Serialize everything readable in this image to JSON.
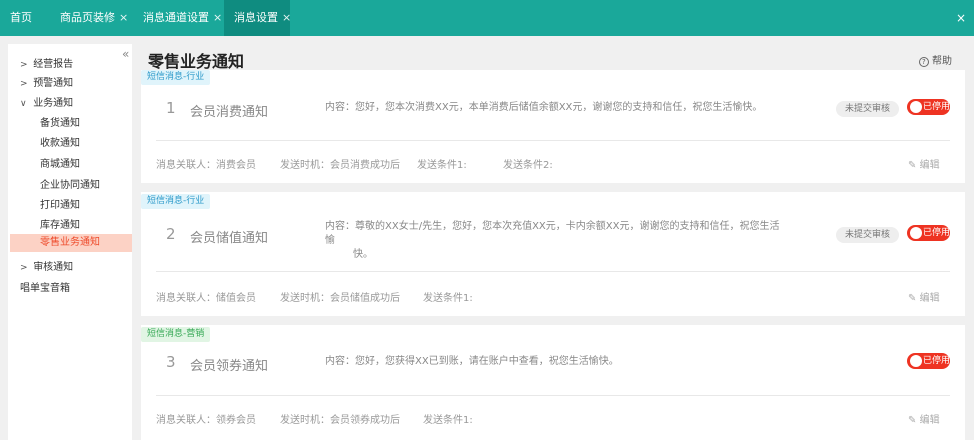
{
  "topbar": {
    "tabs": [
      {
        "label": "首页",
        "closable": false
      },
      {
        "label": "商品页装修",
        "closable": true
      },
      {
        "label": "消息通道设置",
        "closable": true
      },
      {
        "label": "消息设置",
        "closable": true,
        "active": true
      }
    ],
    "close_glyph": "×",
    "tab_close_glyph": "×"
  },
  "sidebar": {
    "collapse_glyph": "«",
    "items": [
      {
        "label": "经营报告",
        "chevron": ">"
      },
      {
        "label": "预警通知",
        "chevron": ">"
      },
      {
        "label": "业务通知",
        "chevron": "∨"
      },
      {
        "label": "备货通知"
      },
      {
        "label": "收款通知"
      },
      {
        "label": "商城通知"
      },
      {
        "label": "企业协同通知"
      },
      {
        "label": "打印通知"
      },
      {
        "label": "库存通知"
      },
      {
        "label": "零售业务通知",
        "active": true
      },
      {
        "label": "审核通知",
        "chevron": ">"
      },
      {
        "label": "唱单宝音箱"
      }
    ]
  },
  "main": {
    "title": "零售业务通知",
    "help_icon": "?",
    "help_label": "帮助",
    "edit_label": "编辑",
    "cards": [
      {
        "tag": "短信消息-行业",
        "number": "1",
        "name": "会员消费通知",
        "content": "内容：您好，您本次消费XX元，本单消费后储值余额XX元，谢谢您的支持和信任，祝您生活愉快。",
        "badge": "未提交审核",
        "toggle": "已停用",
        "meta": [
          "消息关联人：消费会员",
          "发送时机：会员消费成功后",
          "发送条件1:",
          "发送条件2:"
        ]
      },
      {
        "tag": "短信消息-行业",
        "number": "2",
        "name": "会员储值通知",
        "content_lines": [
          "内容：尊敬的XX女士/先生，您好，您本次充值XX元，卡内余额XX元，谢谢您的支持和信任，祝您生活愉",
          "快。"
        ],
        "badge": "未提交审核",
        "toggle": "已停用",
        "meta": [
          "消息关联人：储值会员",
          "发送时机：会员储值成功后",
          "发送条件1:"
        ]
      },
      {
        "tag": "短信消息-营销",
        "number": "3",
        "name": "会员领券通知",
        "content": "内容：您好，您获得XX已到账，请在账户中查看，祝您生活愉快。",
        "toggle": "已停用",
        "meta": [
          "消息关联人：领券会员",
          "发送时机：会员领券成功后",
          "发送条件1:"
        ]
      }
    ]
  }
}
